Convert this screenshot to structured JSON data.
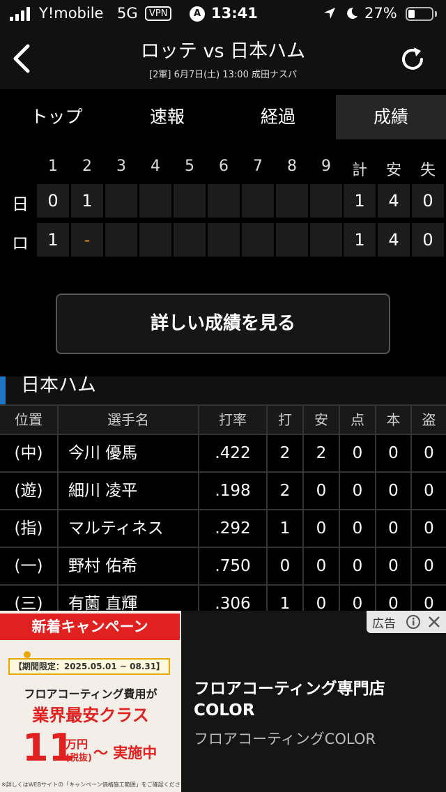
{
  "status_bar": {
    "carrier": "Y!mobile",
    "network": "5G",
    "vpn": "VPN",
    "app_badge": "A",
    "time": "13:41",
    "battery": "27%",
    "battery_level": 0.27
  },
  "header": {
    "title": "ロッテ vs 日本ハム",
    "subtitle": "[2軍] 6月7日(土) 13:00 成田ナスパ",
    "back_icon": "chevron-left-icon",
    "refresh_icon": "refresh-icon"
  },
  "tabs": [
    {
      "label": "トップ",
      "active": false
    },
    {
      "label": "速報",
      "active": false
    },
    {
      "label": "経過",
      "active": false
    },
    {
      "label": "成績",
      "active": true
    }
  ],
  "scoreboard": {
    "columns": [
      "1",
      "2",
      "3",
      "4",
      "5",
      "6",
      "7",
      "8",
      "9",
      "計",
      "安",
      "失"
    ],
    "rows": [
      {
        "team": "日",
        "cells": [
          "0",
          "1",
          "",
          "",
          "",
          "",
          "",
          "",
          "",
          "1",
          "4",
          "0"
        ]
      },
      {
        "team": "ロ",
        "cells": [
          "1",
          "-",
          "",
          "",
          "",
          "",
          "",
          "",
          "",
          "1",
          "4",
          "0"
        ]
      }
    ],
    "accent_color": "#e88a1c"
  },
  "detail_button": "詳しい成績を見る",
  "batting": {
    "team": "日本ハム",
    "team_color": "#1f74c6",
    "headers": [
      "位置",
      "選手名",
      "打率",
      "打",
      "安",
      "点",
      "本",
      "盗"
    ],
    "rows": [
      [
        "(中)",
        "今川 優馬",
        ".422",
        "2",
        "2",
        "0",
        "0",
        "0"
      ],
      [
        "(遊)",
        "細川 凌平",
        ".198",
        "2",
        "0",
        "0",
        "0",
        "0"
      ],
      [
        "(指)",
        "マルティネス",
        ".292",
        "1",
        "0",
        "0",
        "0",
        "0"
      ],
      [
        "(一)",
        "野村 佑希",
        ".750",
        "0",
        "0",
        "0",
        "0",
        "0"
      ],
      [
        "(三)",
        "有薗 直輝",
        ".306",
        "1",
        "0",
        "0",
        "0",
        "0"
      ]
    ]
  },
  "ad": {
    "badge": "広告",
    "ribbon": "新着キャンペーン",
    "period": "【期間限定：2025.05.01 ~ 08.31】",
    "line1": "フロアコーティング費用が",
    "line2": "業界最安クラス",
    "price": "11",
    "unit": "万円",
    "tax": "(税抜)",
    "action": "～ 実施中",
    "fine_print": "※詳しくはWEBサイトの「キャンペーン価格施工範囲」をご確認ください。",
    "title": "フロアコーティング専門店COLOR",
    "advertiser": "フロアコーティングCOLOR",
    "brand_color": "#e12020"
  }
}
